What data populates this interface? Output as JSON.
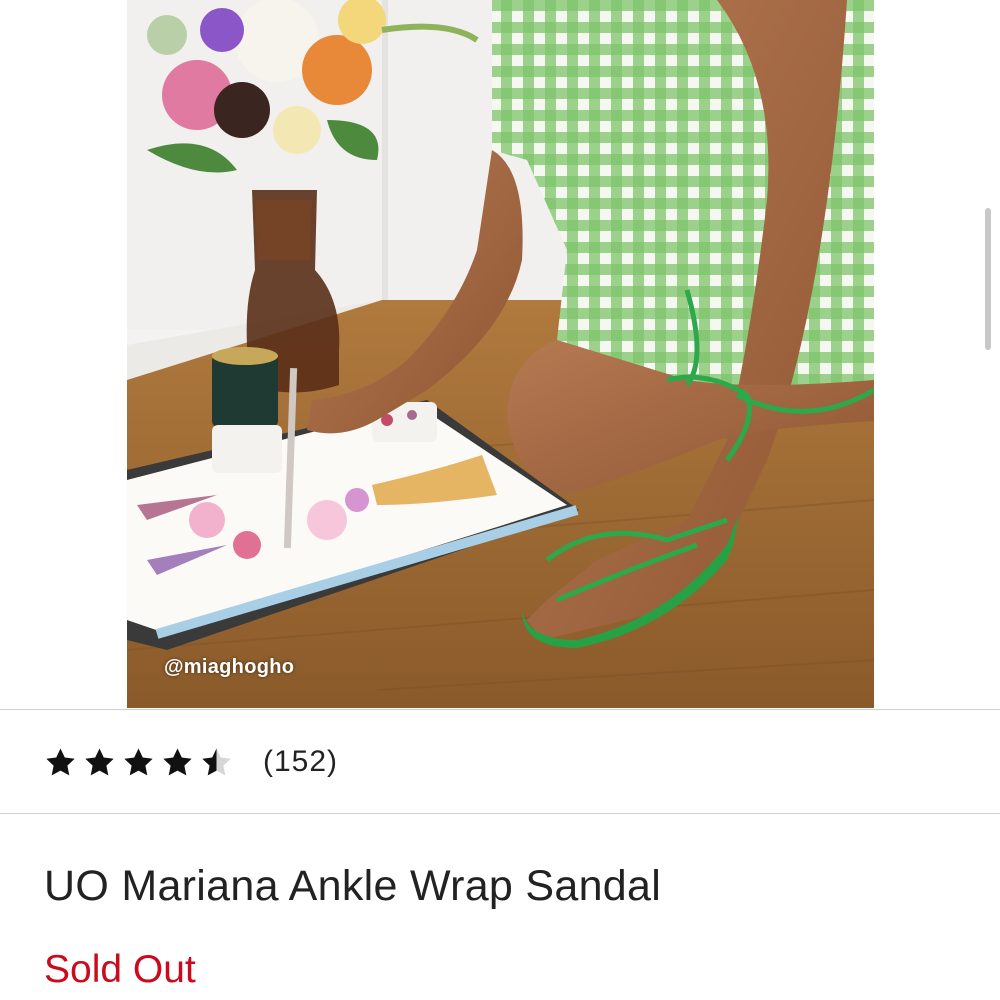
{
  "product_image": {
    "alt": "",
    "credit": "@miaghogho"
  },
  "rating": {
    "value": 4.5,
    "max": 5,
    "count_text": "(152)"
  },
  "product": {
    "title": "UO Mariana Ankle Wrap Sandal",
    "status": "Sold Out"
  },
  "colors": {
    "status": "#cc0a1e",
    "text": "#222222",
    "divider": "#cfcfcf"
  },
  "icons": {
    "rating": "star-icon"
  }
}
